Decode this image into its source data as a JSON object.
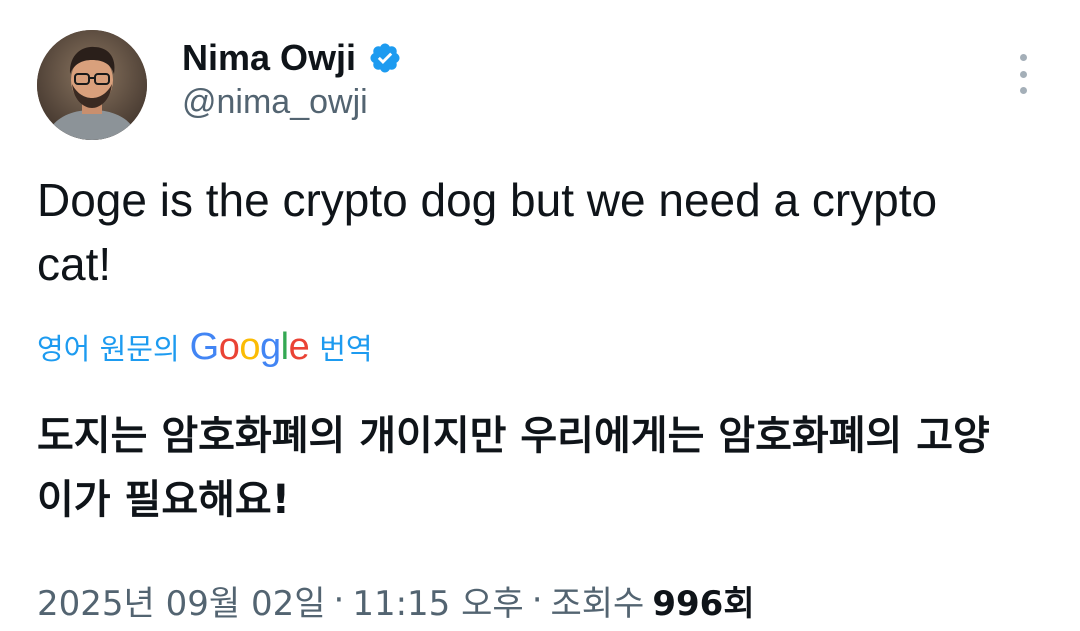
{
  "author": {
    "name": "Nima Owji",
    "handle": "@nima_owji",
    "verified": true
  },
  "tweet": {
    "text": "Doge is the crypto dog but we need a crypto cat!"
  },
  "translation": {
    "prefix": "영어 원문의",
    "google_logo": "Google",
    "suffix": "번역",
    "translated_text": "도지는 암호화폐의 개이지만 우리에게는 암호화폐의 고양이가 필요해요!"
  },
  "meta": {
    "date": "2025년 09월 02일",
    "time": "11:15 오후",
    "separator": "·",
    "views_label": "조회수",
    "views_count": "996회"
  },
  "colors": {
    "link": "#1d9bf0",
    "verified": "#1d9bf0",
    "secondary_text": "#536471",
    "primary_text": "#0f1419"
  },
  "icons": {
    "verified": "verified-badge-icon",
    "more": "more-vertical-icon"
  }
}
